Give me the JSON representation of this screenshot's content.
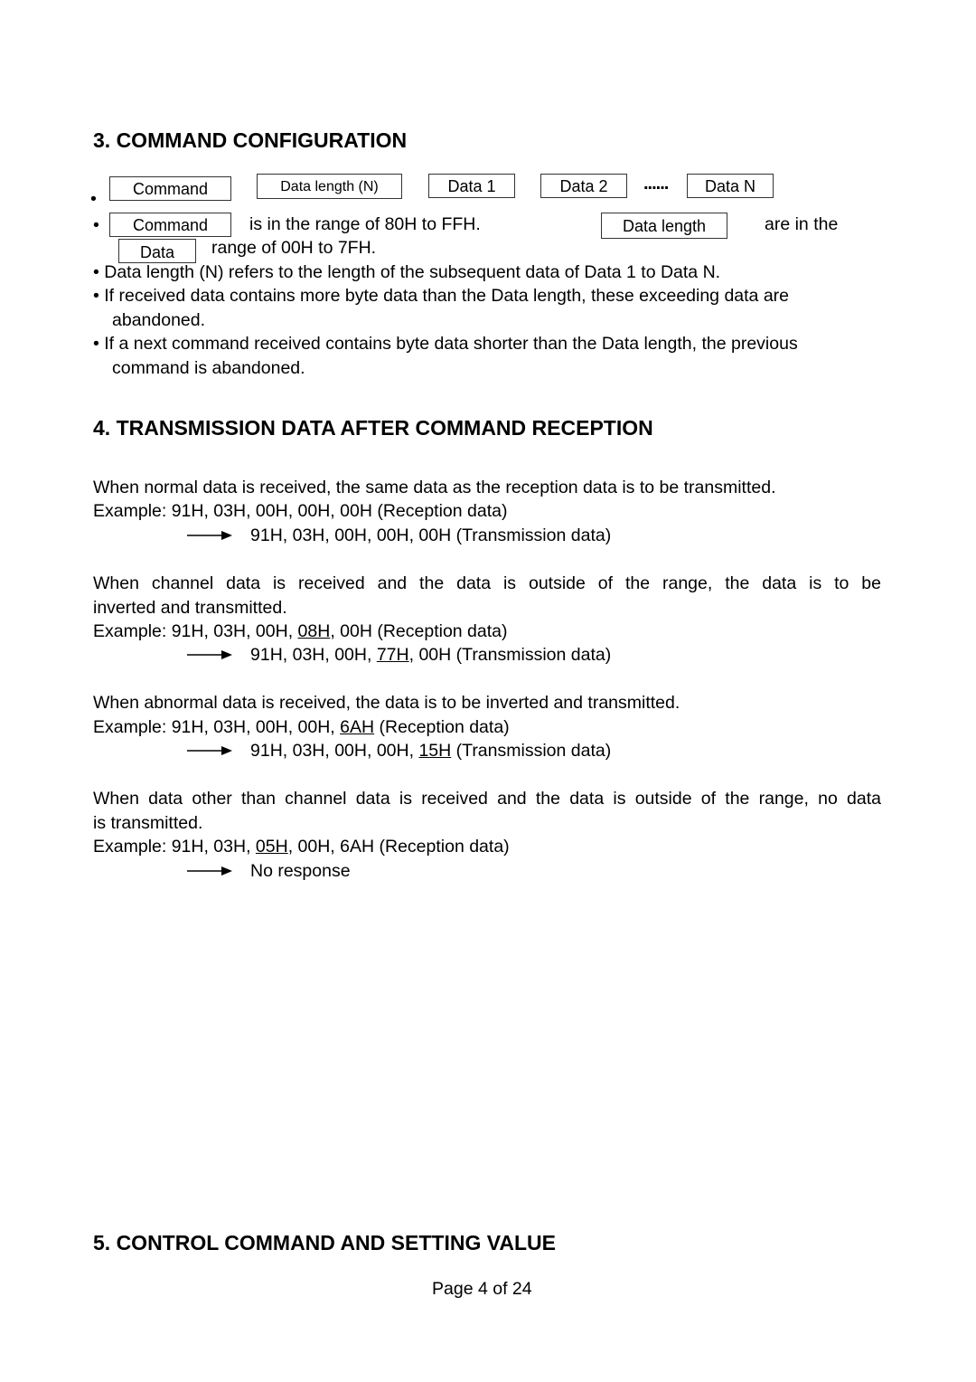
{
  "section3": {
    "title": "3. COMMAND CONFIGURATION",
    "bullet": "•",
    "frame_boxes": [
      "Command",
      "Data length (N)",
      "Data 1",
      "Data 2",
      "Data N"
    ],
    "ellipsis": "......",
    "range_line": {
      "box_command": "Command",
      "text1": "is in the range of 80H to FFH.",
      "box_data_length": "Data length",
      "text2": "are in the",
      "box_data": "Data",
      "text3": "range of 00H to 7FH."
    },
    "notes": [
      "Data length (N) refers to the length of the subsequent data of Data 1 to Data N.",
      "If received data contains more byte data than the Data length, these exceeding data are",
      "abandoned.",
      "If a next command received contains byte data shorter than the Data length, the previous",
      "command is abandoned."
    ]
  },
  "section4": {
    "title": "4. TRANSMISSION DATA AFTER COMMAND RECEPTION",
    "cases": [
      {
        "desc": [
          "When normal data is received, the same data as the reception data is to be transmitted."
        ],
        "example_prefix": "Example: 91H, 03H, 00H, 00H, 00H (Reception data)",
        "response": "91H, 03H, 00H, 00H, 00H (Transmission data)"
      },
      {
        "desc": [
          "When channel data is received and the data is outside of the range, the data is to be",
          "inverted and transmitted."
        ],
        "ex_a": "Example: 91H, 03H, 00H, ",
        "ex_u": "08H",
        "ex_b": ", 00H (Reception data)",
        "resp_a": "91H, 03H, 00H, ",
        "resp_u": "77H",
        "resp_b": ", 00H (Transmission data)"
      },
      {
        "desc": [
          "When abnormal data is received, the data is to be inverted and transmitted."
        ],
        "ex_a": "Example: 91H, 03H, 00H, 00H, ",
        "ex_u": "6AH",
        "ex_b": " (Reception data)",
        "resp_a": "91H, 03H, 00H, 00H, ",
        "resp_u": "15H",
        "resp_b": " (Transmission data)"
      },
      {
        "desc": [
          "When data other than channel data is received and the data is outside of the range, no data",
          "is transmitted."
        ],
        "ex_a": "Example: 91H, 03H, ",
        "ex_u": "05H",
        "ex_b": ", 00H, 6AH (Reception data)",
        "response": "No response"
      }
    ]
  },
  "section5": {
    "title": "5. CONTROL COMMAND AND SETTING VALUE"
  },
  "footer": {
    "page": "Page 4 of 24"
  }
}
